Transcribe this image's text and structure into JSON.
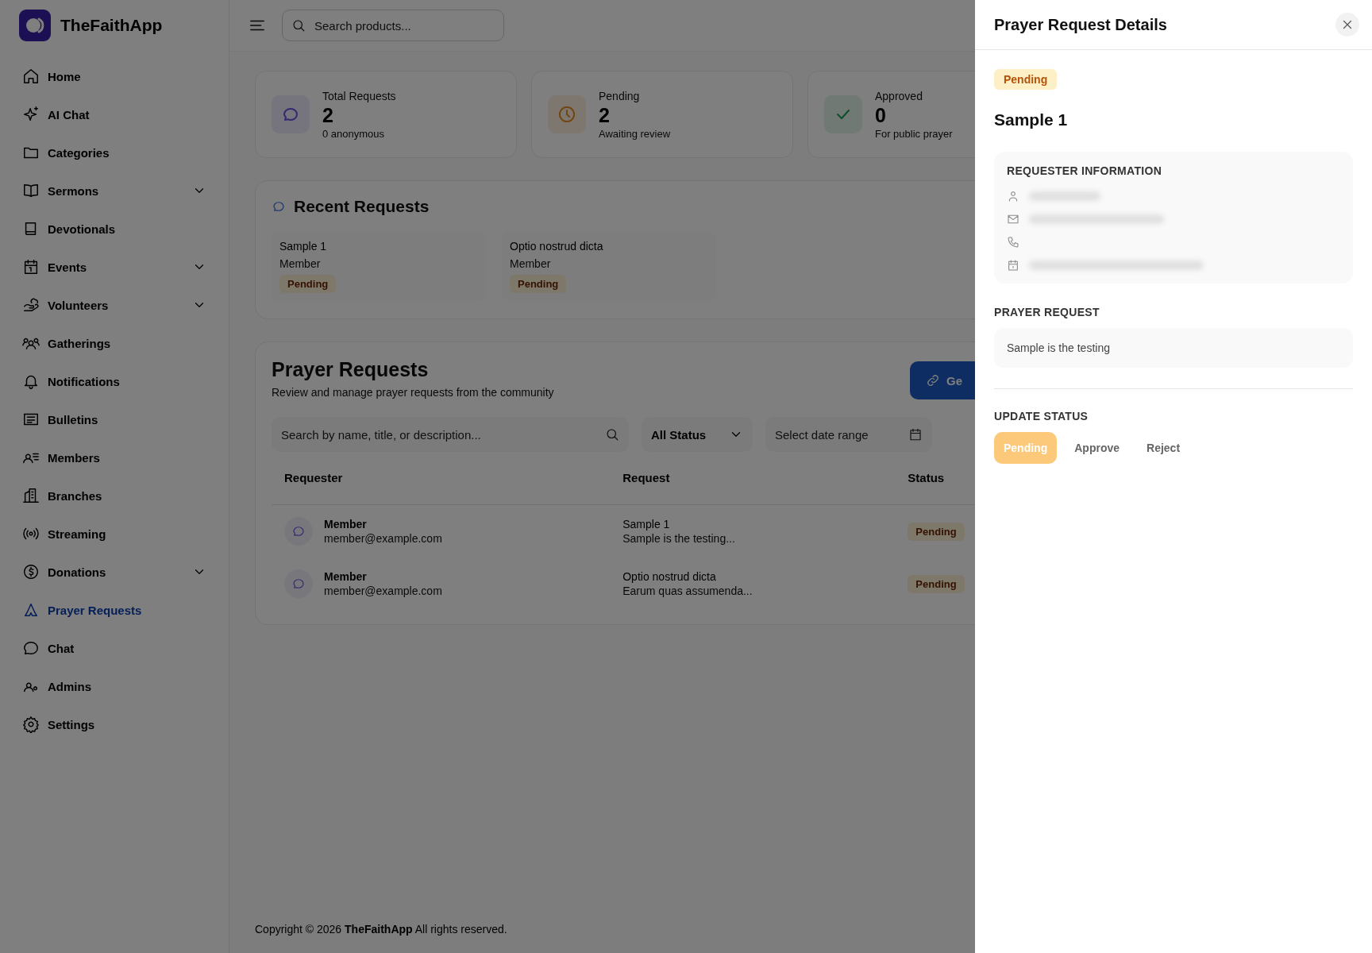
{
  "app": {
    "name": "TheFaithApp"
  },
  "sidebar": {
    "items": [
      {
        "label": "Home",
        "selected": false,
        "expandable": false
      },
      {
        "label": "AI Chat",
        "selected": false,
        "expandable": false
      },
      {
        "label": "Categories",
        "selected": false,
        "expandable": false
      },
      {
        "label": "Sermons",
        "selected": false,
        "expandable": true
      },
      {
        "label": "Devotionals",
        "selected": false,
        "expandable": false
      },
      {
        "label": "Events",
        "selected": false,
        "expandable": true
      },
      {
        "label": "Volunteers",
        "selected": false,
        "expandable": true
      },
      {
        "label": "Gatherings",
        "selected": false,
        "expandable": false
      },
      {
        "label": "Notifications",
        "selected": false,
        "expandable": false
      },
      {
        "label": "Bulletins",
        "selected": false,
        "expandable": false
      },
      {
        "label": "Members",
        "selected": false,
        "expandable": false
      },
      {
        "label": "Branches",
        "selected": false,
        "expandable": false
      },
      {
        "label": "Streaming",
        "selected": false,
        "expandable": false
      },
      {
        "label": "Donations",
        "selected": false,
        "expandable": true
      },
      {
        "label": "Prayer Requests",
        "selected": true,
        "expandable": false
      },
      {
        "label": "Chat",
        "selected": false,
        "expandable": false
      },
      {
        "label": "Admins",
        "selected": false,
        "expandable": false
      },
      {
        "label": "Settings",
        "selected": false,
        "expandable": false
      }
    ]
  },
  "topbar": {
    "search": {
      "placeholder": "Search products..."
    }
  },
  "stats": [
    {
      "label": "Total Requests",
      "value": "2",
      "note": "0 anonymous"
    },
    {
      "label": "Pending",
      "value": "2",
      "note": "Awaiting review"
    },
    {
      "label": "Approved",
      "value": "0",
      "note": "For public prayer"
    }
  ],
  "recent_requests": {
    "title": "Recent Requests",
    "items": [
      {
        "title": "Sample 1",
        "requester": "Member",
        "status": "Pending"
      },
      {
        "title": "Optio nostrud dicta",
        "requester": "Member",
        "status": "Pending"
      }
    ]
  },
  "prayer_requests": {
    "title": "Prayer Requests",
    "subtitle": "Review and manage prayer requests from the community",
    "button": "Ge",
    "search": {
      "placeholder": "Search by name, title, or description..."
    },
    "status_filter": "All Status",
    "date_range": {
      "placeholder": "Select date range"
    },
    "table": {
      "columns": [
        "Requester",
        "Request",
        "Status"
      ],
      "rows": [
        {
          "name": "Member",
          "email": "member@example.com",
          "title": "Sample 1",
          "excerpt": "Sample is the testing...",
          "status": "Pending"
        },
        {
          "name": "Member",
          "email": "member@example.com",
          "title": "Optio nostrud dicta",
          "excerpt": "Earum quas assumenda...",
          "status": "Pending"
        }
      ]
    }
  },
  "footer": {
    "text": "Copyright © 2026 **TheFaithApp** All rights reserved."
  },
  "drawer": {
    "title": "Prayer Request Details",
    "status": "Pending",
    "request_title": "Sample 1",
    "requester_heading": "REQUESTER INFORMATION",
    "requester_fields": [
      {
        "kind": "person",
        "blurred": true
      },
      {
        "kind": "email",
        "blurred": true
      },
      {
        "kind": "phone",
        "blurred": false
      },
      {
        "kind": "date",
        "blurred": true
      }
    ],
    "prayer_heading": "PRAYER REQUEST",
    "prayer_text": "Sample is the testing",
    "update_heading": "UPDATE STATUS",
    "status_options": [
      {
        "label": "Pending",
        "selected": true
      },
      {
        "label": "Approve",
        "selected": false
      },
      {
        "label": "Reject",
        "selected": false
      }
    ]
  }
}
